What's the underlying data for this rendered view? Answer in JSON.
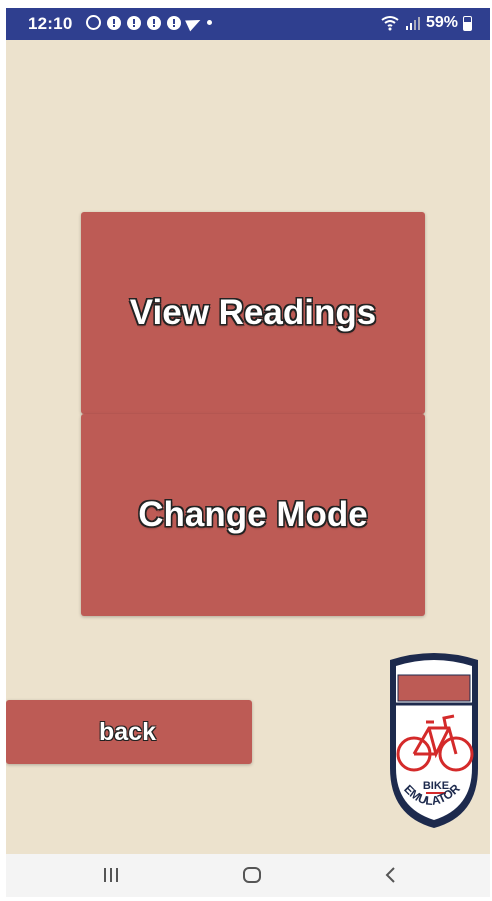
{
  "status_bar": {
    "time": "12:10",
    "battery": "59%",
    "notification_icons": [
      "whatsapp-icon",
      "alert-icon",
      "alert-icon",
      "alert-icon",
      "alert-icon",
      "telegram-icon",
      "dot-icon"
    ],
    "right_icons": [
      "wifi-icon",
      "signal-icon",
      "battery-icon"
    ],
    "battery_level": 0.59,
    "background_color": "#2f3f8f"
  },
  "main": {
    "view_readings_label": "View Readings",
    "change_mode_label": "Change Mode",
    "back_label": "back",
    "button_color": "#bd5b55",
    "background_color": "#ece2cd"
  },
  "logo": {
    "text_top": "BIKE",
    "text_bottom": "EMULATOR",
    "icon": "bicycle-icon",
    "colors": {
      "shield_border": "#1d2a4d",
      "banner": "#bd5b55",
      "bike": "#d42a2a"
    }
  },
  "nav_bar": {
    "icons": [
      "recent-apps-icon",
      "home-icon",
      "back-arrow-icon"
    ]
  }
}
